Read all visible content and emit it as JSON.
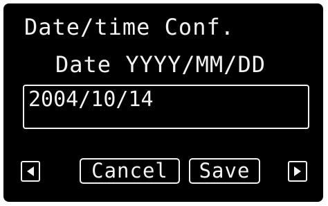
{
  "dialog": {
    "title": "Date/time Conf.",
    "field_label": "Date YYYY/MM/DD",
    "date_value": "2004/10/14"
  },
  "buttons": {
    "prev_icon": "left-arrow-icon",
    "cancel_label": "Cancel",
    "save_label": "Save",
    "next_icon": "right-arrow-icon"
  },
  "colors": {
    "background": "#000000",
    "foreground": "#f2f2f2"
  }
}
